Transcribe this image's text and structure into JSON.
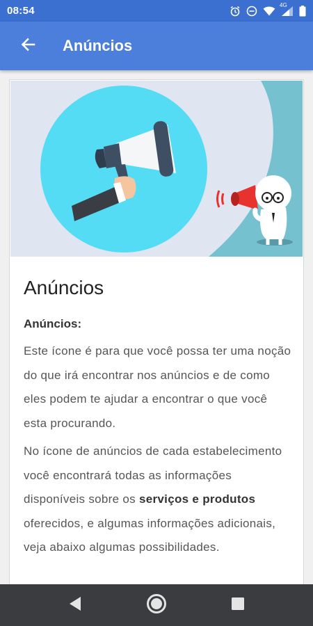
{
  "status_bar": {
    "time": "08:54",
    "network_label": "4G",
    "icons": [
      "alarm-icon",
      "do-not-disturb-icon",
      "wifi-icon",
      "signal-icon",
      "battery-icon"
    ]
  },
  "app_bar": {
    "title": "Anúncios",
    "back_icon": "arrow-back-icon"
  },
  "article": {
    "title": "Anúncios",
    "subheading": "Anúncios:",
    "paragraph1": "Este ícone é para que você possa ter uma noção do que irá encontrar nos anúncios e de como eles podem te ajudar a encontrar o que você esta procurando.",
    "paragraph2_before": "No ícone de anúncios de cada estabelecimento você encontrará todas as informações disponíveis sobre os ",
    "paragraph2_bold": "serviços e produtos",
    "paragraph2_after": " oferecidos, e algumas informações adicionais, veja abaixo algumas possibilidades."
  },
  "nav_bar": {
    "icons": [
      "back-triangle-icon",
      "home-circle-icon",
      "recents-square-icon"
    ]
  },
  "colors": {
    "status_bar": "#3b6fd0",
    "app_bar": "#4c7edb",
    "nav_bar": "#3a3c3f",
    "hero_background": "#dfe6f2",
    "hero_circle": "#55dcf5",
    "hero_teal": "#76c1cf"
  }
}
